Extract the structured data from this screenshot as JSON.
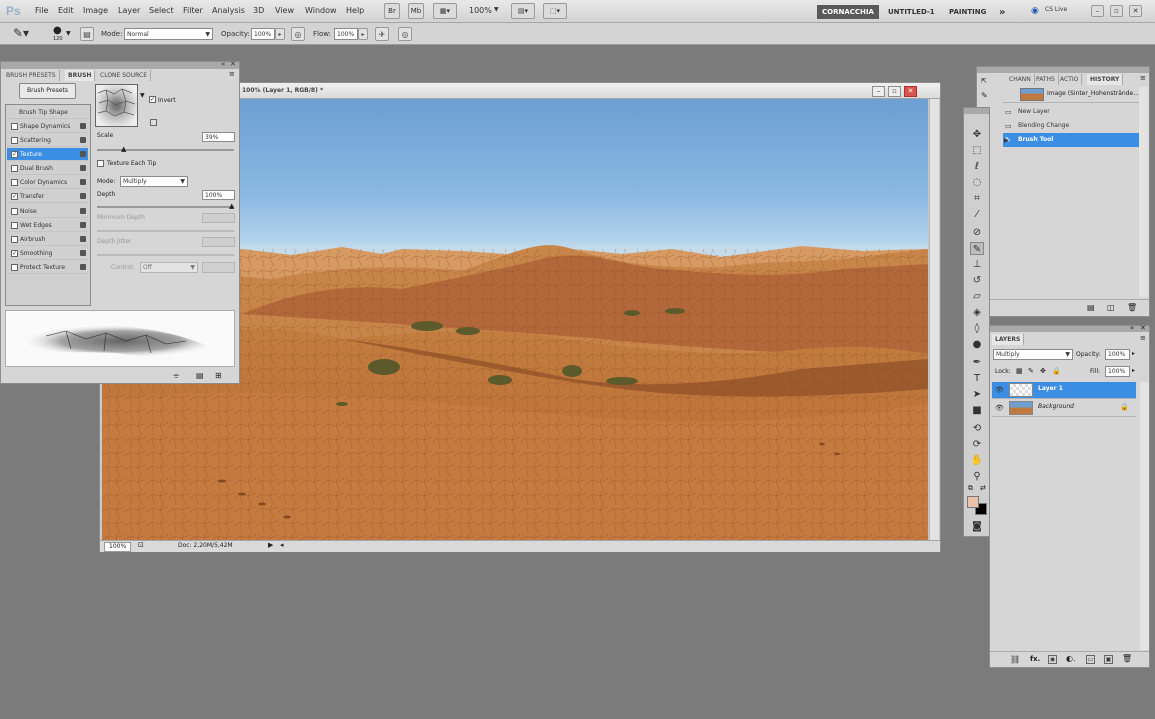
{
  "app": {
    "logo": "Ps"
  },
  "menu": [
    "File",
    "Edit",
    "Image",
    "Layer",
    "Select",
    "Filter",
    "Analysis",
    "3D",
    "View",
    "Window",
    "Help"
  ],
  "appbar": {
    "zoom": "100%"
  },
  "workspaces": {
    "active": "CORNACCHIA",
    "others": [
      "UNTITLED-1",
      "PAINTING"
    ],
    "more": "»",
    "cslive": "CS Live"
  },
  "options": {
    "mode_label": "Mode:",
    "mode_value": "Normal",
    "opacity_label": "Opacity:",
    "opacity_value": "100%",
    "flow_label": "Flow:",
    "flow_value": "100%",
    "brush_size": "120"
  },
  "document": {
    "title": "100% (Layer 1, RGB/8) *",
    "zoom": "100%",
    "doc_info": "Doc: 2,20M/5,42M"
  },
  "brush_panel": {
    "tabs": [
      "BRUSH PRESETS",
      "BRUSH",
      "CLONE SOURCE"
    ],
    "presets_button": "Brush Presets",
    "tip_shape": "Brush Tip Shape",
    "options": [
      {
        "label": "Shape Dynamics",
        "checked": false
      },
      {
        "label": "Scattering",
        "checked": false
      },
      {
        "label": "Texture",
        "checked": true,
        "selected": true
      },
      {
        "label": "Dual Brush",
        "checked": false
      },
      {
        "label": "Color Dynamics",
        "checked": false
      },
      {
        "label": "Transfer",
        "checked": true
      },
      {
        "label": "Noise",
        "checked": false
      },
      {
        "label": "Wet Edges",
        "checked": false
      },
      {
        "label": "Airbrush",
        "checked": false
      },
      {
        "label": "Smoothing",
        "checked": true
      },
      {
        "label": "Protect Texture",
        "checked": false
      }
    ],
    "invert_label": "Invert",
    "scale_label": "Scale",
    "scale_value": "39%",
    "texture_each_tip": "Texture Each Tip",
    "mode_label": "Mode:",
    "mode_value": "Multiply",
    "depth_label": "Depth",
    "depth_value": "100%",
    "min_depth_label": "Minimum Depth",
    "depth_jitter_label": "Depth Jitter",
    "control_label": "Control:",
    "control_value": "Off"
  },
  "history_panel": {
    "tabs": [
      "CHANN",
      "PATHS",
      "ACTIO",
      "HISTORY"
    ],
    "snapshot": "Image (Sinter_Hohenstrände...",
    "steps": [
      "New Layer",
      "Blending Change",
      "Brush Tool"
    ]
  },
  "layers_panel": {
    "tab": "LAYERS",
    "blend_mode": "Multiply",
    "opacity_label": "Opacity:",
    "opacity_value": "100%",
    "lock_label": "Lock:",
    "fill_label": "Fill:",
    "fill_value": "100%",
    "layers": [
      {
        "name": "Layer 1",
        "selected": true
      },
      {
        "name": "Background",
        "locked": true
      }
    ]
  },
  "colors": {
    "accent": "#3b8ee4",
    "foreground": "#e9c3a8",
    "background": "#000000"
  }
}
